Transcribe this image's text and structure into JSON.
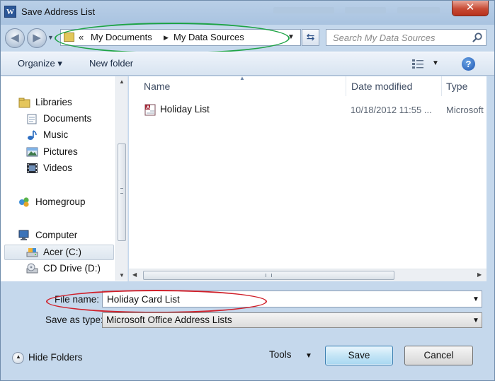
{
  "window": {
    "title": "Save Address List",
    "app_icon_letter": "W",
    "close_glyph": "✕"
  },
  "nav": {
    "back_glyph": "◀",
    "forward_glyph": "▶",
    "breadcrumb_overflow": "«",
    "breadcrumbs": [
      "My Documents",
      "My Data Sources"
    ],
    "search_placeholder": "Search My Data Sources",
    "refresh_glyph": "⇆"
  },
  "commandbar": {
    "organize_label": "Organize ▾",
    "new_folder_label": "New folder",
    "help_glyph": "?"
  },
  "sidebar": {
    "items": [
      {
        "label": "Libraries",
        "icon": "libraries-icon"
      },
      {
        "label": "Documents",
        "icon": "documents-icon"
      },
      {
        "label": "Music",
        "icon": "music-icon"
      },
      {
        "label": "Pictures",
        "icon": "pictures-icon"
      },
      {
        "label": "Videos",
        "icon": "videos-icon"
      },
      {
        "label": "Homegroup",
        "icon": "homegroup-icon"
      },
      {
        "label": "Computer",
        "icon": "computer-icon"
      },
      {
        "label": "Acer (C:)",
        "icon": "drive-icon",
        "selected": true
      },
      {
        "label": "CD Drive (D:)",
        "icon": "cd-drive-icon"
      }
    ]
  },
  "filelist": {
    "columns": [
      "Name",
      "Date modified",
      "Type"
    ],
    "rows": [
      {
        "name": "Holiday List",
        "date": "10/18/2012 11:55 ...",
        "type": "Microsoft"
      }
    ]
  },
  "form": {
    "filename_label": "File name:",
    "filename_value": "Holiday Card List",
    "savetype_label": "Save as type:",
    "savetype_value": "Microsoft Office Address Lists"
  },
  "footer": {
    "hide_folders_label": "Hide Folders",
    "tools_label": "Tools",
    "save_label": "Save",
    "cancel_label": "Cancel"
  },
  "colors": {
    "annotation_green": "#1ea346",
    "annotation_red": "#d0202a",
    "window_frame": "#c5d8ec"
  }
}
